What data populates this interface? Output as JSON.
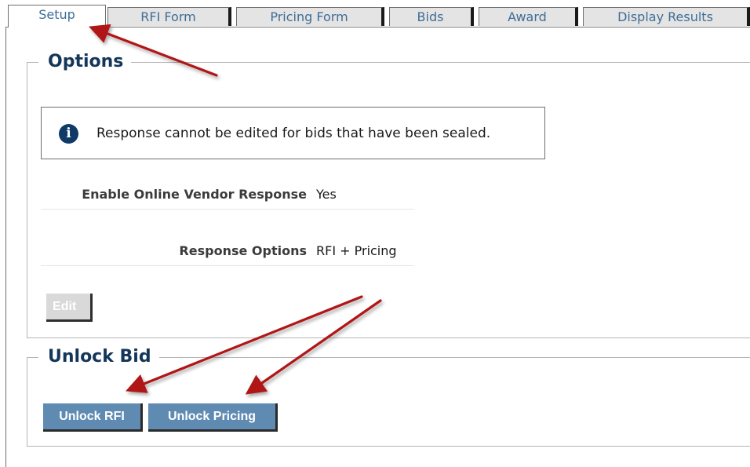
{
  "tabs": [
    {
      "label": "Setup",
      "active": true
    },
    {
      "label": "RFI Form"
    },
    {
      "label": "Pricing Form"
    },
    {
      "label": "Bids"
    },
    {
      "label": "Award"
    },
    {
      "label": "Display Results"
    }
  ],
  "options_section": {
    "legend": "Options",
    "notice": "Response cannot be edited for bids that have been sealed.",
    "notice_icon": "info-icon",
    "rows": [
      {
        "label": "Enable Online Vendor Response",
        "value": "Yes"
      },
      {
        "label": "Response Options",
        "value": "RFI + Pricing"
      }
    ],
    "edit_button": "Edit"
  },
  "unlock_section": {
    "legend": "Unlock Bid",
    "unlock_rfi_button": "Unlock RFI",
    "unlock_pricing_button": "Unlock Pricing"
  },
  "colors": {
    "accent_blue": "#5f8bb2",
    "heading_navy": "#143659",
    "annotation_arrow": "#b01818"
  }
}
